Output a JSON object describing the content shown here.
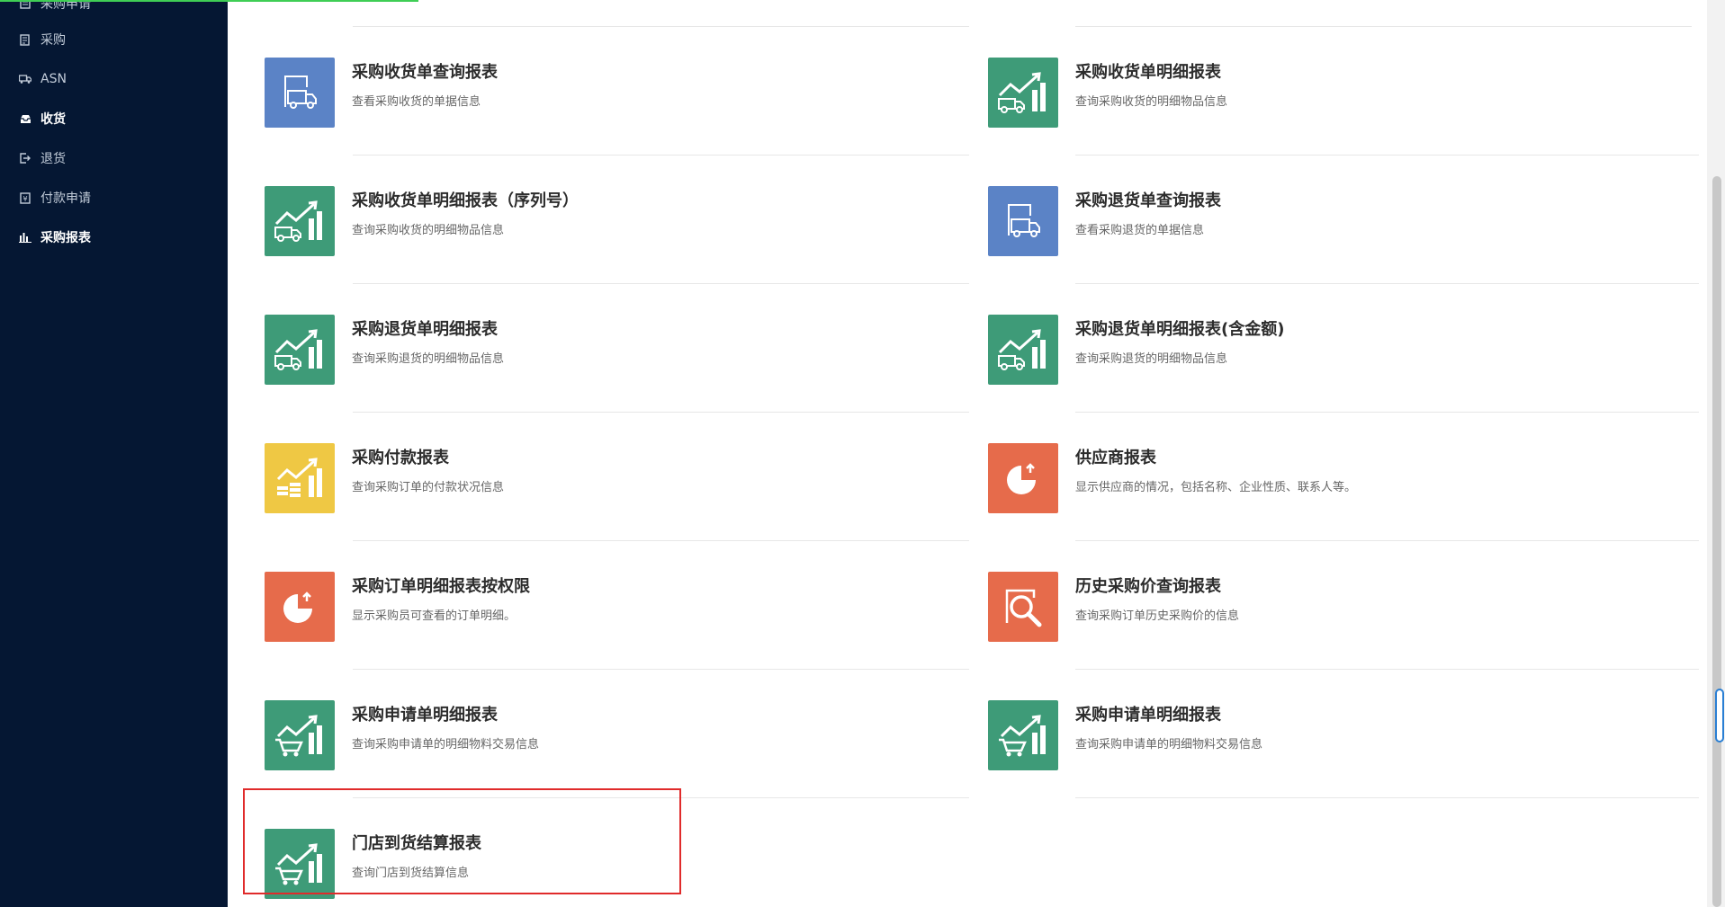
{
  "sidebar": {
    "items": [
      {
        "label": "采购申请",
        "icon": "document-icon"
      },
      {
        "label": "采购",
        "icon": "list-icon"
      },
      {
        "label": "ASN",
        "icon": "truck-icon"
      },
      {
        "label": "收货",
        "icon": "inbox-icon"
      },
      {
        "label": "退货",
        "icon": "exit-icon"
      },
      {
        "label": "付款申请",
        "icon": "payment-icon"
      },
      {
        "label": "采购报表",
        "icon": "bar-chart-icon"
      }
    ]
  },
  "reports": [
    {
      "title": "采购收货单查询报表",
      "desc": "查看采购收货的单据信息",
      "color": "#5b83c6",
      "icon": "truck-document-icon"
    },
    {
      "title": "采购收货单明细报表",
      "desc": "查询采购收货的明细物品信息",
      "color": "#3e9b78",
      "icon": "truck-chart-icon"
    },
    {
      "title": "采购收货单明细报表（序列号）",
      "desc": "查询采购收货的明细物品信息",
      "color": "#3e9b78",
      "icon": "truck-chart-icon"
    },
    {
      "title": "采购退货单查询报表",
      "desc": "查看采购退货的单据信息",
      "color": "#5b83c6",
      "icon": "truck-document-icon"
    },
    {
      "title": "采购退货单明细报表",
      "desc": "查询采购退货的明细物品信息",
      "color": "#3e9b78",
      "icon": "truck-chart-icon"
    },
    {
      "title": "采购退货单明细报表(含金额)",
      "desc": "查询采购退货的明细物品信息",
      "color": "#3e9b78",
      "icon": "truck-chart-icon"
    },
    {
      "title": "采购付款报表",
      "desc": "查询采购订单的付款状况信息",
      "color": "#efc844",
      "icon": "coins-chart-icon"
    },
    {
      "title": "供应商报表",
      "desc": "显示供应商的情况，包括名称、企业性质、联系人等。",
      "color": "#e66b4b",
      "icon": "pie-chart-icon"
    },
    {
      "title": "采购订单明细报表按权限",
      "desc": "显示采购员可查看的订单明细。",
      "color": "#e66b4b",
      "icon": "pie-chart-icon"
    },
    {
      "title": "历史采购价查询报表",
      "desc": "查询采购订单历史采购价的信息",
      "color": "#e66b4b",
      "icon": "magnifier-icon"
    },
    {
      "title": "采购申请单明细报表",
      "desc": "查询采购申请单的明细物料交易信息",
      "color": "#3e9b78",
      "icon": "cart-chart-icon"
    },
    {
      "title": "采购申请单明细报表",
      "desc": "查询采购申请单的明细物料交易信息",
      "color": "#3e9b78",
      "icon": "cart-chart-icon"
    },
    {
      "title": "门店到货结算报表",
      "desc": "查询门店到货结算信息",
      "color": "#3e9b78",
      "icon": "cart-chart-icon"
    }
  ]
}
